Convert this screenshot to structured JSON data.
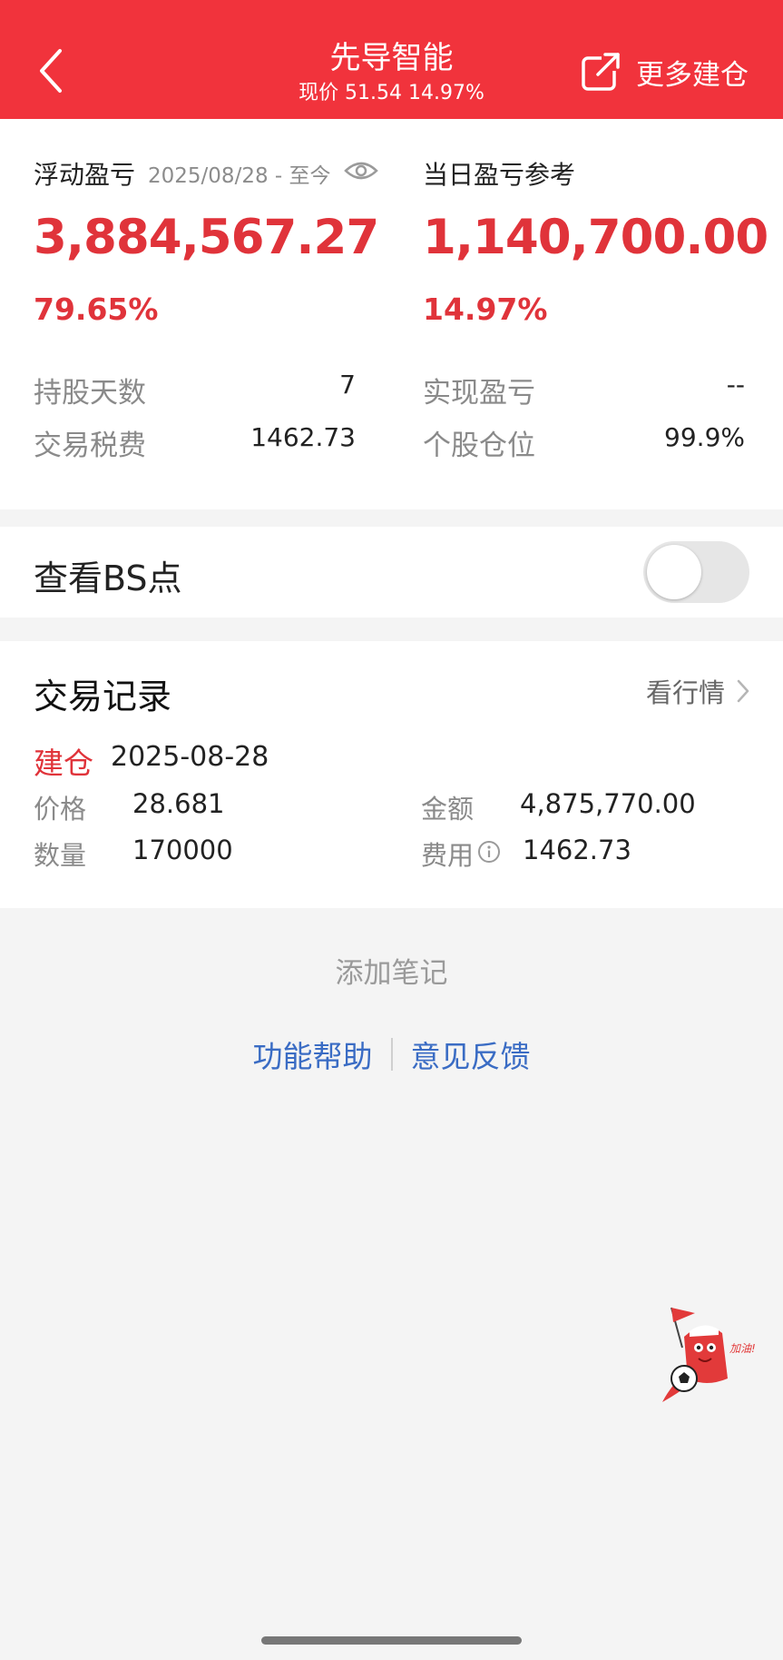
{
  "header": {
    "title": "先导智能",
    "subtitle": "现价 51.54 14.97%",
    "more_label": "更多建仓"
  },
  "floating": {
    "title": "浮动盈亏",
    "date_range": "2025/08/28 - 至今",
    "value": "3,884,567.27",
    "pct": "79.65%",
    "hold_days_label": "持股天数",
    "hold_days_value": "7",
    "tax_label": "交易税费",
    "tax_value": "1462.73"
  },
  "daily": {
    "title": "当日盈亏参考",
    "value": "1,140,700.00",
    "pct": "14.97%",
    "realized_label": "实现盈亏",
    "realized_value": "--",
    "position_label": "个股仓位",
    "position_value": "99.9%"
  },
  "bs": {
    "label": "查看BS点",
    "enabled": false
  },
  "records": {
    "title": "交易记录",
    "market_label": "看行情",
    "entry": {
      "type": "建仓",
      "date": "2025-08-28",
      "price_label": "价格",
      "price_value": "28.681",
      "amount_label": "金额",
      "amount_value": "4,875,770.00",
      "qty_label": "数量",
      "qty_value": "170000",
      "fee_label": "费用",
      "fee_value": "1462.73"
    }
  },
  "footer": {
    "add_note": "添加笔记",
    "help": "功能帮助",
    "feedback": "意见反馈"
  },
  "mascot": {
    "text": "加油!"
  },
  "colors": {
    "header_bg": "#f1333c",
    "accent_red": "#e0333a",
    "link_blue": "#3a6cc4"
  }
}
